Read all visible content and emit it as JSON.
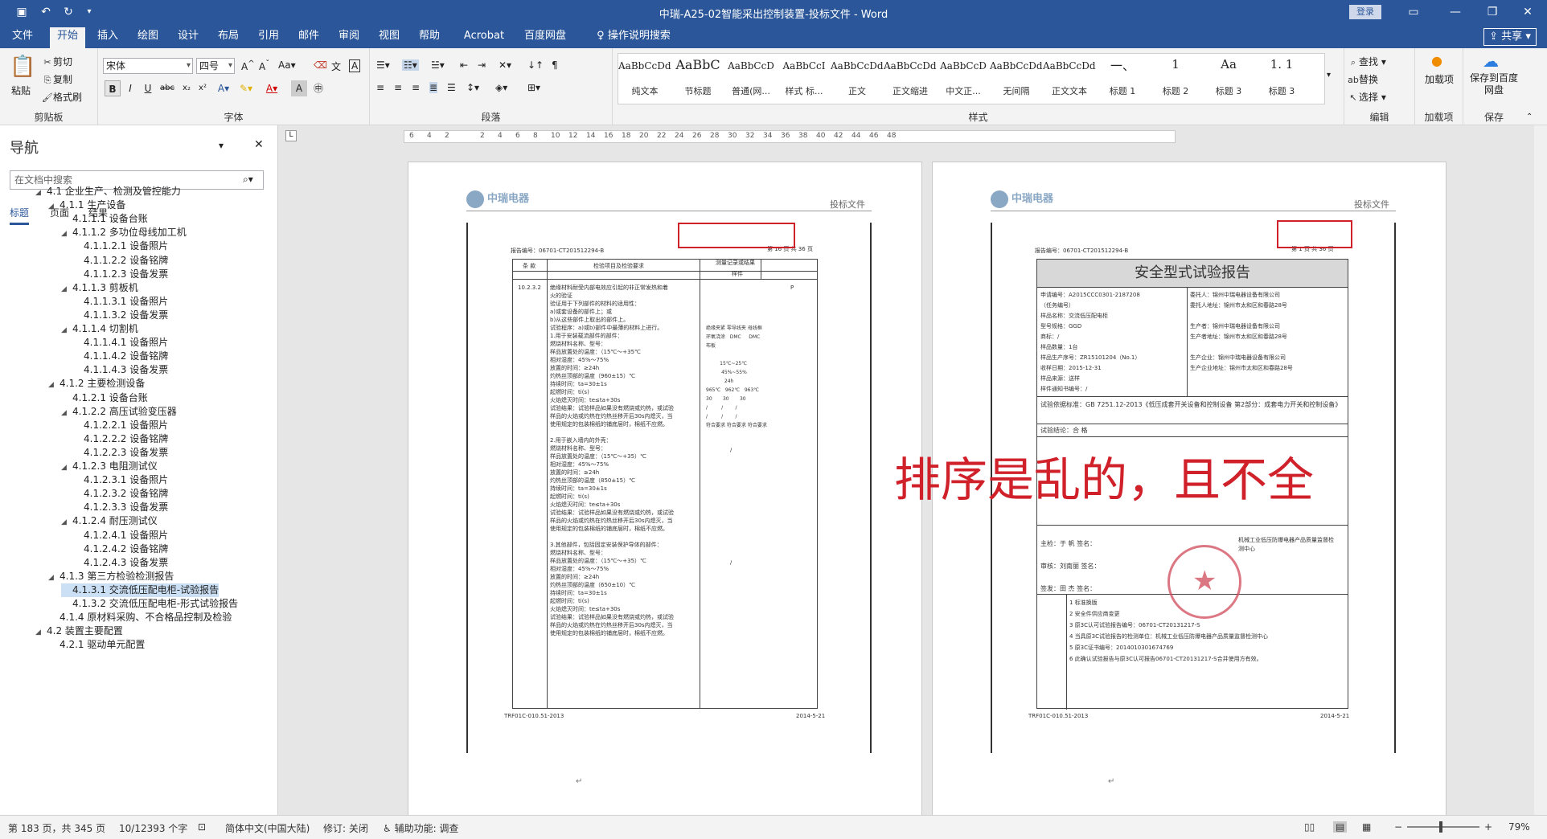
{
  "titlebar": {
    "doc_title": "中瑞-A25-02智能采出控制装置-投标文件 - Word",
    "login": "登录"
  },
  "tabs": [
    "文件",
    "开始",
    "插入",
    "绘图",
    "设计",
    "布局",
    "引用",
    "邮件",
    "审阅",
    "视图",
    "帮助",
    "Acrobat",
    "百度网盘",
    "操作说明搜索"
  ],
  "share": "共享",
  "ribbon": {
    "clipboard": {
      "label": "剪贴板",
      "paste": "粘贴",
      "cut": "剪切",
      "copy": "复制",
      "format_painter": "格式刷"
    },
    "font": {
      "label": "字体",
      "name": "宋体",
      "size": "四号"
    },
    "paragraph": {
      "label": "段落"
    },
    "styles": {
      "label": "样式",
      "items": [
        {
          "preview": "AaBbCcDdI",
          "name": "纯文本"
        },
        {
          "preview": "AaBbC",
          "name": "节标题"
        },
        {
          "preview": "AaBbCcD",
          "name": "普通(网..."
        },
        {
          "preview": "AaBbCcI",
          "name": "样式 标..."
        },
        {
          "preview": "AaBbCcDdI",
          "name": "正文"
        },
        {
          "preview": "AaBbCcDdI",
          "name": "正文缩进"
        },
        {
          "preview": "AaBbCcD",
          "name": "中文正..."
        },
        {
          "preview": "AaBbCcDdI",
          "name": "无间隔"
        },
        {
          "preview": "AaBbCcDdI",
          "name": "正文文本"
        },
        {
          "preview": "一、",
          "name": "标题 1"
        },
        {
          "preview": "1",
          "name": "标题 2"
        },
        {
          "preview": "Aa",
          "name": "标题 3"
        },
        {
          "preview": "1. 1",
          "name": "标题 3"
        }
      ]
    },
    "editing": {
      "label": "编辑",
      "find": "查找",
      "replace": "替换",
      "select": "选择"
    },
    "addins": {
      "label": "加载项",
      "btn": "加载项"
    },
    "save": {
      "label": "保存",
      "btn": "保存到百度网盘"
    }
  },
  "nav": {
    "title": "导航",
    "search_placeholder": "在文档中搜索",
    "tabs": [
      "标题",
      "页面",
      "结果"
    ],
    "items": [
      {
        "text": "4.1 企业生产、检测及管控能力",
        "level": 1,
        "tri": "◢"
      },
      {
        "text": "4.1.1 生产设备",
        "level": 2,
        "tri": "◢"
      },
      {
        "text": "4.1.1.1 设备台账",
        "level": 3,
        "tri": ""
      },
      {
        "text": "4.1.1.2 多功位母线加工机",
        "level": 3,
        "tri": "◢"
      },
      {
        "text": "4.1.1.2.1 设备照片",
        "level": 4,
        "tri": ""
      },
      {
        "text": "4.1.1.2.2 设备铭牌",
        "level": 4,
        "tri": ""
      },
      {
        "text": "4.1.1.2.3 设备发票",
        "level": 4,
        "tri": ""
      },
      {
        "text": "4.1.1.3 剪板机",
        "level": 3,
        "tri": "◢"
      },
      {
        "text": "4.1.1.3.1 设备照片",
        "level": 4,
        "tri": ""
      },
      {
        "text": "4.1.1.3.2 设备发票",
        "level": 4,
        "tri": ""
      },
      {
        "text": "4.1.1.4 切割机",
        "level": 3,
        "tri": "◢"
      },
      {
        "text": "4.1.1.4.1 设备照片",
        "level": 4,
        "tri": ""
      },
      {
        "text": "4.1.1.4.2 设备铭牌",
        "level": 4,
        "tri": ""
      },
      {
        "text": "4.1.1.4.3 设备发票",
        "level": 4,
        "tri": ""
      },
      {
        "text": "4.1.2 主要检测设备",
        "level": 2,
        "tri": "◢"
      },
      {
        "text": "4.1.2.1 设备台账",
        "level": 3,
        "tri": ""
      },
      {
        "text": "4.1.2.2 高压试验变压器",
        "level": 3,
        "tri": "◢"
      },
      {
        "text": "4.1.2.2.1 设备照片",
        "level": 4,
        "tri": ""
      },
      {
        "text": "4.1.2.2.2 设备铭牌",
        "level": 4,
        "tri": ""
      },
      {
        "text": "4.1.2.2.3 设备发票",
        "level": 4,
        "tri": ""
      },
      {
        "text": "4.1.2.3 电阻测试仪",
        "level": 3,
        "tri": "◢"
      },
      {
        "text": "4.1.2.3.1 设备照片",
        "level": 4,
        "tri": ""
      },
      {
        "text": "4.1.2.3.2 设备铭牌",
        "level": 4,
        "tri": ""
      },
      {
        "text": "4.1.2.3.3 设备发票",
        "level": 4,
        "tri": ""
      },
      {
        "text": "4.1.2.4 耐压测试仪",
        "level": 3,
        "tri": "◢"
      },
      {
        "text": "4.1.2.4.1 设备照片",
        "level": 4,
        "tri": ""
      },
      {
        "text": "4.1.2.4.2 设备铭牌",
        "level": 4,
        "tri": ""
      },
      {
        "text": "4.1.2.4.3 设备发票",
        "level": 4,
        "tri": ""
      },
      {
        "text": "4.1.3 第三方检验检测报告",
        "level": 2,
        "tri": "◢"
      },
      {
        "text": "4.1.3.1 交流低压配电柜-试验报告",
        "level": 3,
        "tri": "",
        "selected": true
      },
      {
        "text": "4.1.3.2 交流低压配电柜-形式试验报告",
        "level": 3,
        "tri": ""
      },
      {
        "text": "4.1.4 原材料采购、不合格品控制及检验",
        "level": 2,
        "tri": ""
      },
      {
        "text": "4.2 装置主要配置",
        "level": 1,
        "tri": "◢"
      },
      {
        "text": "4.2.1 驱动单元配置",
        "level": 2,
        "tri": ""
      }
    ]
  },
  "ruler_marks": [
    "6",
    "4",
    "2",
    "",
    "2",
    "4",
    "6",
    "8",
    "10",
    "12",
    "14",
    "16",
    "18",
    "20",
    "22",
    "24",
    "26",
    "28",
    "30",
    "32",
    "34",
    "36",
    "38",
    "40",
    "42",
    "44",
    "46",
    "48"
  ],
  "pages": {
    "logo": "中瑞电器",
    "bid_label": "投标文件",
    "left": {
      "report_no": "报告编号：06701-CT201512294-B",
      "page_no": "第 16 页 共 36 页",
      "col_clause": "条 款",
      "col_item": "检验项目及检验要求",
      "col_result": "测量记录或结果",
      "col_sample": "样件",
      "clause": "10.2.3.2",
      "footer_left": "TRF01C-010.51-2013",
      "footer_right": "2014-5-21",
      "body": [
        "绝缘材料耐受内部电效应引起的非正常发热和着",
        "火的验证",
        "验证用于下列部件的材料的适用性：",
        "a)或套设备的部件上；或",
        "b)从这些部件上取出的部件上。",
        "试验程序：a)或b)部件中最薄的材料上进行。",
        "1.用于安装载流部件的部件：",
        "燃烧材料名称、型号：",
        "样品放置处的温度：（15℃～+35℃",
        "相对湿度：45%～75%",
        "放置的时间：≥24h",
        "灼热丝顶部的温度（960±15）℃",
        "持续时间：ta=30±1s",
        "起燃时间：ti(s)",
        "火焰熄灭时间：te≤ta+30s",
        "试验结果：试验样品如果没有燃烧或灼热，或试验",
        "样品的火焰或灼热在灼热丝移开后30s内熄灭，当",
        "使用规定的包装棉纸的铺底层时，棉纸不应燃。",
        "",
        "2.用于嵌入墙内的外壳：",
        "燃烧材料名称、型号：",
        "样品放置处的温度：（15℃～+35）℃",
        "相对湿度：45%～75%",
        "放置的时间：≥24h",
        "灼热丝顶部的温度（850±15）℃",
        "持续时间：ta=30±1s",
        "起燃时间：ti(s)",
        "火焰熄灭时间：te≤ta+30s",
        "试验结果：试验样品如果没有燃烧或灼热，或试验",
        "样品的火焰或灼热在灼热丝移开后30s内熄灭，当",
        "使用规定的包装棉纸的铺底层时，棉纸不应燃。",
        "",
        "3.其他部件，包括固定安装保护导体的部件：",
        "燃烧材料名称、型号：",
        "样品放置处的温度：（15℃～+35）℃",
        "相对湿度：45%～75%",
        "放置的时间：≥24h",
        "灼热丝顶部的温度（650±10）℃",
        "持续时间：ta=30±1s",
        "起燃时间：ti(s)",
        "火焰熄灭时间：te≤ta+30s",
        "试验结果：试验样品如果没有燃烧或灼热，或试验",
        "样品的火焰或灼热在灼热丝移开后30s内熄灭，当",
        "使用规定的包装棉纸的铺底层时，棉纸不应燃。"
      ]
    },
    "right": {
      "report_no": "报告编号：06701-CT201512294-B",
      "page_no": "第 1 页 共 36 页",
      "title": "安全型式试验报告",
      "footer_left": "TRF01C-010.51-2013",
      "footer_right": "2014-5-21",
      "info_left": [
        "申请编号：A2015CCC0301-2187208",
        "（任务编号）",
        "样品名称：交流低压配电柜",
        "型号规格：GGD",
        "商标：/",
        "样品数量：1台",
        "样品生产序号：ZR15101204（No.1）",
        "收样日期：2015-12-31",
        "样品来源：送样",
        "样件通知书编号：/"
      ],
      "info_right": [
        "委托人：锦州中瑞电器设备有限公司",
        "委托人地址：锦州市太和区和春路28号",
        "",
        "生产者：锦州中瑞电器设备有限公司",
        "生产者地址：锦州市太和区和春路28号",
        "",
        "生产企业：锦州中瑞电器设备有限公司",
        "生产企业地址：锦州市太和区和春路28号"
      ],
      "basis": "试验依据标准：GB 7251.12-2013《低压成套开关设备和控制设备 第2部分：成套电力开关和控制设备》",
      "conclusion": "试验结论：合 格",
      "sign_lines": [
        "主检：于 帆 签名：",
        "审核：刘南丽 签名：",
        "签发：田 杰 签名："
      ],
      "org": "机械工业低压防爆电器产品质量监督检测中心",
      "changes": [
        "标准换版",
        "安全件供应商变更",
        "原3C认可试验报告编号：06701-CT20131217-S",
        "当具原3C试验报告的检测单位：机械工业低压防爆电器产品质量监督检测中心",
        "原3C证书编号：2014010301674769",
        "此确认试验报告与原3C认可报告06701-CT20131217-S合并使用方有效。"
      ]
    }
  },
  "annotation": "排序是乱的，且不全",
  "statusbar": {
    "page": "第 183 页，共 345 页",
    "words": "10/12393 个字",
    "lang": "简体中文(中国大陆)",
    "track": "修订: 关闭",
    "access": "辅助功能: 调查",
    "zoom": "79%"
  }
}
